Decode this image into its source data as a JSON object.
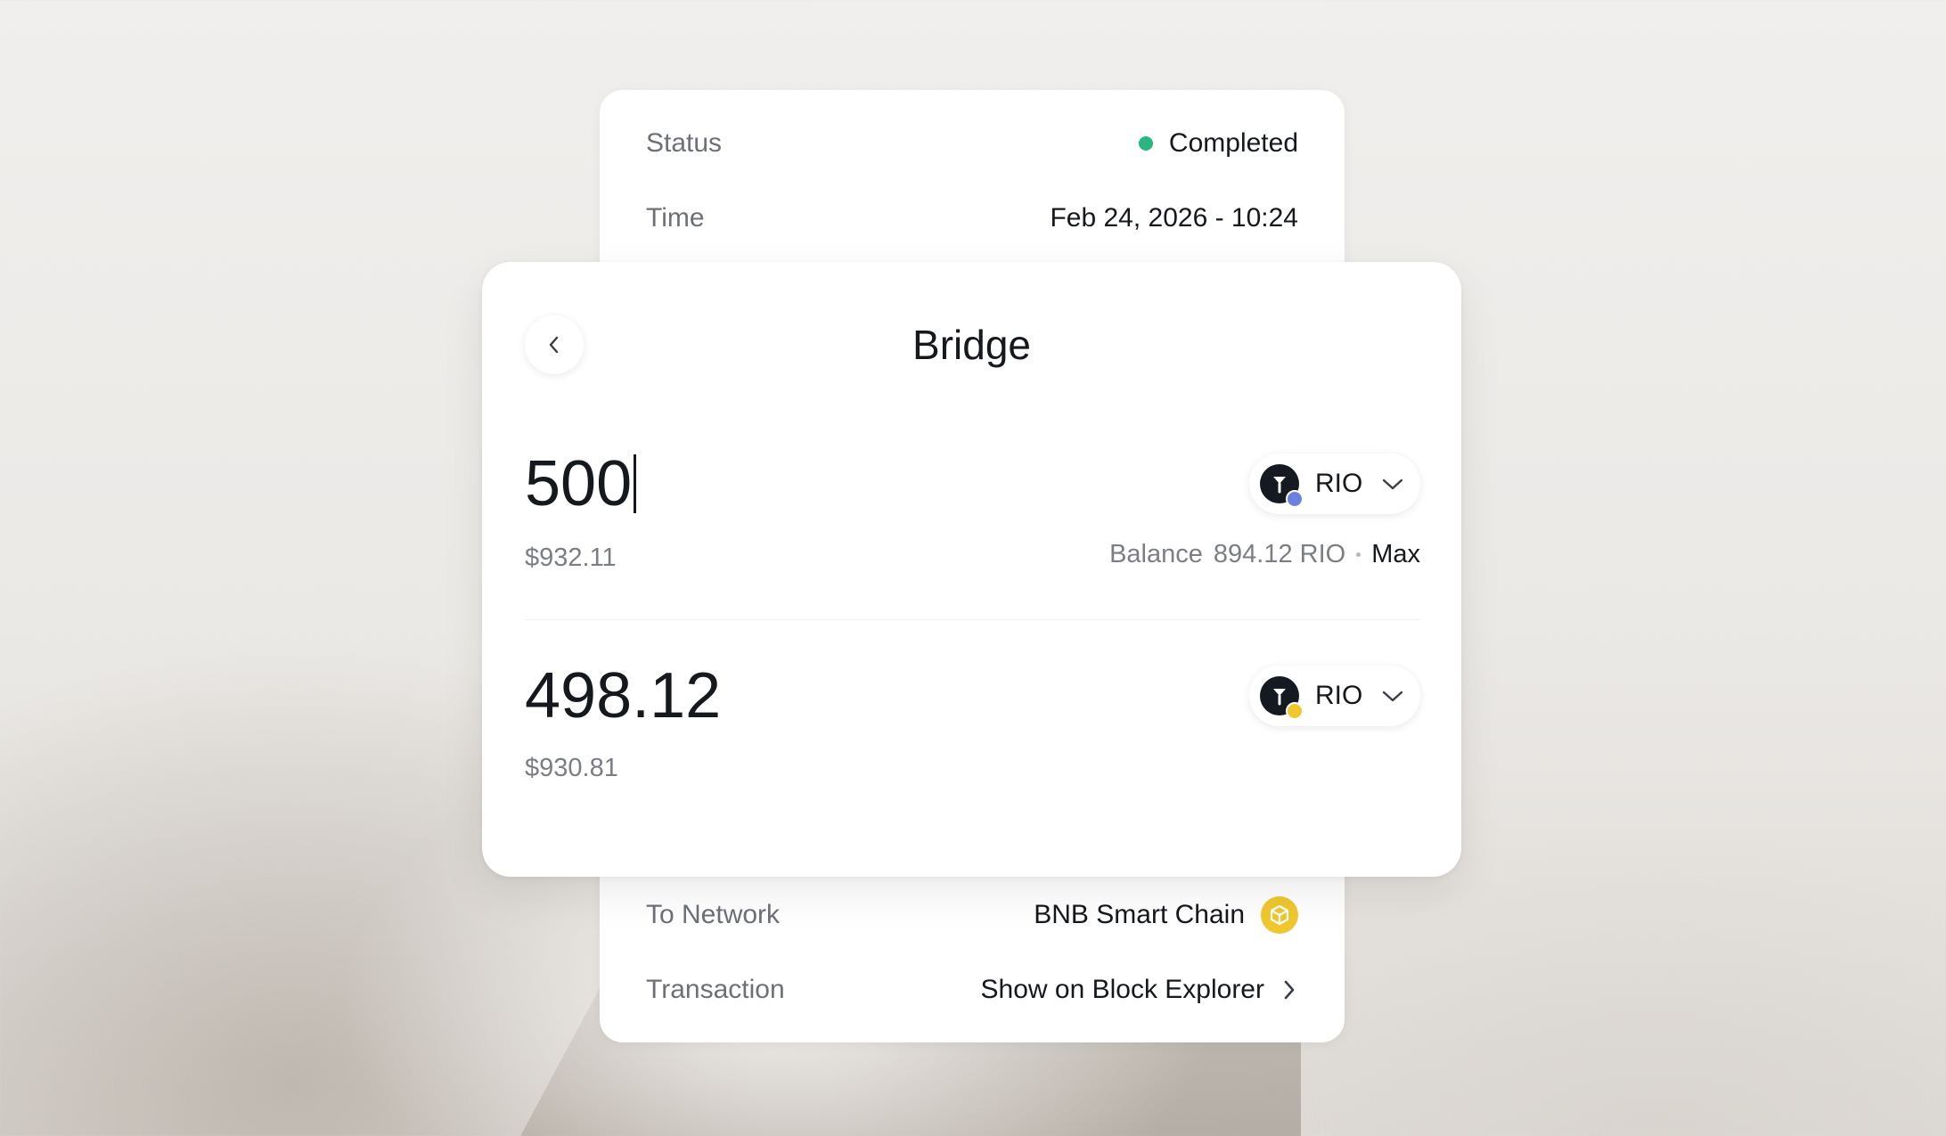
{
  "details": {
    "status_label": "Status",
    "status_value": "Completed",
    "status_color": "#2bb67f",
    "time_label": "Time",
    "time_value": "Feb 24, 2026 - 10:24",
    "network_label": "To Network",
    "network_value": "BNB Smart Chain",
    "network_icon": "bnb-chain-icon",
    "transaction_label": "Transaction",
    "transaction_value": "Show on Block Explorer"
  },
  "bridge": {
    "title": "Bridge",
    "from": {
      "amount": "500",
      "usd": "$932.11",
      "token": "RIO",
      "chain_badge_icon": "ethereum-badge-icon",
      "balance_label": "Balance",
      "balance_value": "894.12 RIO",
      "max_label": "Max"
    },
    "to": {
      "amount": "498.12",
      "usd": "$930.81",
      "token": "RIO",
      "chain_badge_icon": "bnb-badge-icon"
    }
  },
  "colors": {
    "ethereum_badge": "#6d7fe0",
    "bnb": "#f0c72f"
  }
}
